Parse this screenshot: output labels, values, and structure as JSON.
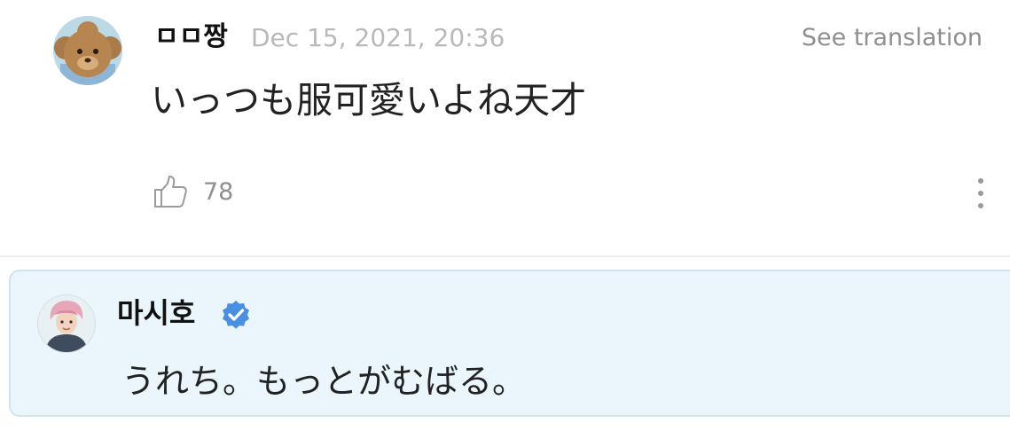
{
  "comment": {
    "username": "ㅁㅁ짱",
    "timestamp": "Dec 15, 2021, 20:36",
    "see_translation_label": "See translation",
    "text": "いっつも服可愛いよね天才",
    "like_count": "78",
    "icons": {
      "avatar": "teddy-bear-avatar",
      "like": "thumbs-up-icon",
      "more": "more-vertical-icon"
    }
  },
  "reply": {
    "username": "마시호",
    "verified": true,
    "text": "うれち。もっとがむばる。",
    "icons": {
      "avatar": "artist-avatar",
      "verified": "verified-badge-icon"
    }
  },
  "colors": {
    "timestamp": "#b9b9b9",
    "secondary_text": "#8f8f8f",
    "reply_background": "#eaf6fc",
    "reply_border": "#cfe4ef",
    "verified_badge": "#4a8fe0"
  }
}
